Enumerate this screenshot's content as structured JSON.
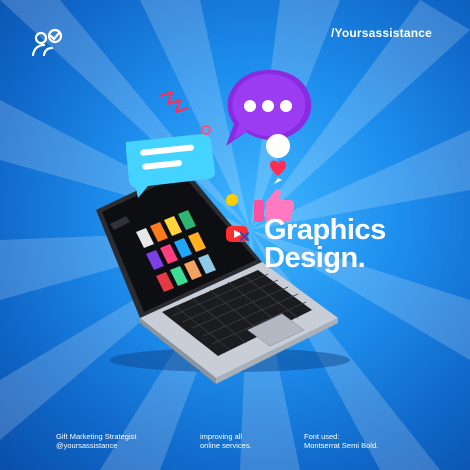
{
  "brand": {
    "handle": "/Yoursassistance"
  },
  "headline": {
    "line1": "Graphics",
    "line2": "Design."
  },
  "footer": {
    "col1": {
      "line1": "Gift   Marketing Strategist",
      "line2": "@yoursassistance"
    },
    "col2": {
      "line1": "improving all",
      "line2": "online services."
    },
    "col3": {
      "line1": "Font used:",
      "line2": "Montserrat Semi Bold."
    }
  },
  "icons": [
    "team-logo-icon",
    "chat-bubble-icon",
    "message-card-icon",
    "heart-icon",
    "thumbs-up-icon",
    "play-icon",
    "laptop-icon"
  ],
  "colors": {
    "background": "#1e8fee",
    "accent_purple": "#8a2be2",
    "accent_cyan": "#44d2ff",
    "accent_pink": "#ff4fa0",
    "accent_red": "#ff2d2d",
    "accent_yellow": "#ffcc00"
  }
}
